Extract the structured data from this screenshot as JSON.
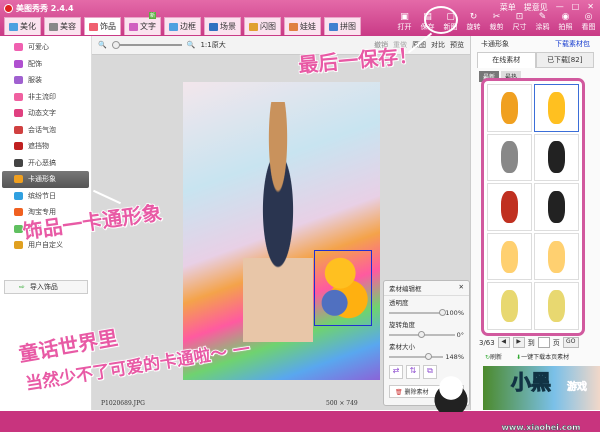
{
  "app": {
    "title": "美图秀秀 2.4.4",
    "menu": "菜单",
    "feedback": "提意见",
    "minimize": "—",
    "maximize": "□",
    "close": "✕"
  },
  "tabs": [
    {
      "label": "美化",
      "color": "#4ca0e0"
    },
    {
      "label": "美容",
      "color": "#888"
    },
    {
      "label": "饰品",
      "color": "#f06070"
    },
    {
      "label": "文字",
      "color": "#d060c0",
      "badge": "新"
    },
    {
      "label": "边框",
      "color": "#50a0e0"
    },
    {
      "label": "场景",
      "color": "#3070c0"
    },
    {
      "label": "闪图",
      "color": "#e0a030"
    },
    {
      "label": "娃娃",
      "color": "#e08040"
    },
    {
      "label": "拼图",
      "color": "#4080d0"
    }
  ],
  "tools": [
    {
      "label": "打开",
      "g": "▣"
    },
    {
      "label": "保存",
      "g": "▤"
    },
    {
      "label": "新图",
      "g": "▢"
    },
    {
      "label": "旋转",
      "g": "↻"
    },
    {
      "label": "裁剪",
      "g": "✂"
    },
    {
      "label": "尺寸",
      "g": "⊡"
    },
    {
      "label": "涂鸦",
      "g": "✎"
    },
    {
      "label": "拍照",
      "g": "◉"
    },
    {
      "label": "看图",
      "g": "◎"
    }
  ],
  "sidebar": {
    "items": [
      {
        "label": "可爱心",
        "color": "#f060b0"
      },
      {
        "label": "配饰",
        "color": "#b050d0"
      },
      {
        "label": "服装",
        "color": "#a060d0"
      },
      {
        "label": "非主流印",
        "color": "#f060a0"
      },
      {
        "label": "动态文字",
        "color": "#e04080"
      },
      {
        "label": "会话气泡",
        "color": "#d04040"
      },
      {
        "label": "遮挡物",
        "color": "#c02020"
      },
      {
        "label": "开心恶搞",
        "color": "#444"
      },
      {
        "label": "卡通形象",
        "color": "#f0a020"
      },
      {
        "label": "缤纷节日",
        "color": "#30a0e0"
      },
      {
        "label": "淘宝专用",
        "color": "#f06020"
      },
      {
        "label": "炫彩",
        "color": "#60c060"
      },
      {
        "label": "用户自定义",
        "color": "#e0a020"
      }
    ],
    "active": 8,
    "import_label": "导入饰品"
  },
  "main": {
    "zoom_label": "1:1原大",
    "undo": "撤销",
    "redo": "重做",
    "original": "原图",
    "compare": "对比",
    "preview": "预览",
    "filename": "P1020689.JPG",
    "dimensions": "500 × 749"
  },
  "dialog": {
    "title": "素材编辑框",
    "close": "✕",
    "opacity_label": "透明度",
    "opacity_value": "100%",
    "opacity": 1.0,
    "rotation_label": "旋转角度",
    "rotation_value": "0°",
    "rotation": 0,
    "size_label": "素材大小",
    "size_value": "148%",
    "size": 0.74,
    "delete_label": "删除素材"
  },
  "right": {
    "title": "卡通形象",
    "download_pack": "下载素材包",
    "tab_online": "在线素材",
    "tab_downloaded": "已下载[82]",
    "sort_new": "最新",
    "sort_hot": "最热",
    "page": "3/63",
    "goto": "到",
    "page_unit": "页",
    "go": "GO",
    "refresh": "刷新",
    "download_page": "一键下载本页素材"
  },
  "ad": {
    "title": "小黑",
    "subtitle": "游戏",
    "url": "www.xiaohei.com"
  },
  "overlays": {
    "save": "最后一保存！",
    "cartoon": "饰品一卡通形象",
    "line1": "童话世界里",
    "line2": "当然少不了可爱的卡通啦～ 一"
  }
}
